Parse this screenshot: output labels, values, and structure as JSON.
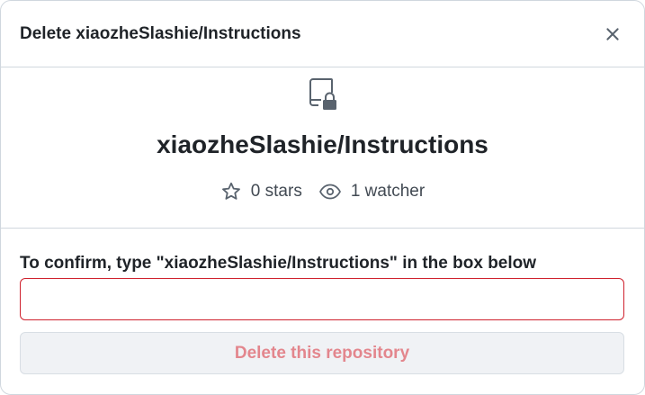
{
  "dialog": {
    "title": "Delete xiaozheSlashie/Instructions",
    "close_icon": "x-icon"
  },
  "repo": {
    "icon": "repo-locked-icon",
    "full_name": "xiaozheSlashie/Instructions",
    "stars_label": "0 stars",
    "stars_icon": "star-icon",
    "watchers_label": "1 watcher",
    "watchers_icon": "eye-icon"
  },
  "confirm": {
    "label": "To confirm, type \"xiaozheSlashie/Instructions\" in the box below",
    "input_value": "",
    "input_border_color": "#cf222e"
  },
  "actions": {
    "delete_label": "Delete this repository",
    "delete_text_color": "#e3868d",
    "delete_disabled": true
  }
}
